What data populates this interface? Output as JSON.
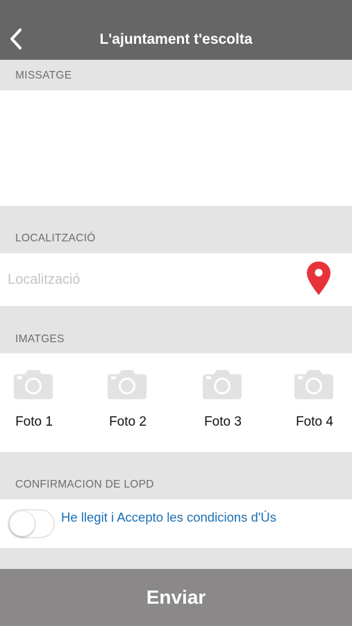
{
  "header": {
    "title": "L'ajuntament t'escolta",
    "back_icon": "chevron-left-icon"
  },
  "message": {
    "section_label": "MISSATGE",
    "value": ""
  },
  "location": {
    "section_label": "LOCALITZACIÓ",
    "placeholder": "Localització",
    "value": "",
    "pin_icon": "map-pin-icon",
    "pin_color": "#e8323a"
  },
  "images": {
    "section_label": "IMATGES",
    "camera_icon": "camera-icon",
    "camera_color": "#e2e2e2",
    "photos": [
      {
        "label": "Foto 1"
      },
      {
        "label": "Foto 2"
      },
      {
        "label": "Foto 3"
      },
      {
        "label": "Foto 4"
      }
    ]
  },
  "lopd": {
    "section_label": "CONFIRMACION DE LOPD",
    "toggle_on": false,
    "consent_text": "He llegit i Accepto les condicions d'Ús",
    "link_color": "#1a6fb3"
  },
  "submit": {
    "label": "Enviar"
  },
  "colors": {
    "navbar": "#666666",
    "section_background": "#e4e4e4",
    "submit_background": "#8a8888"
  }
}
